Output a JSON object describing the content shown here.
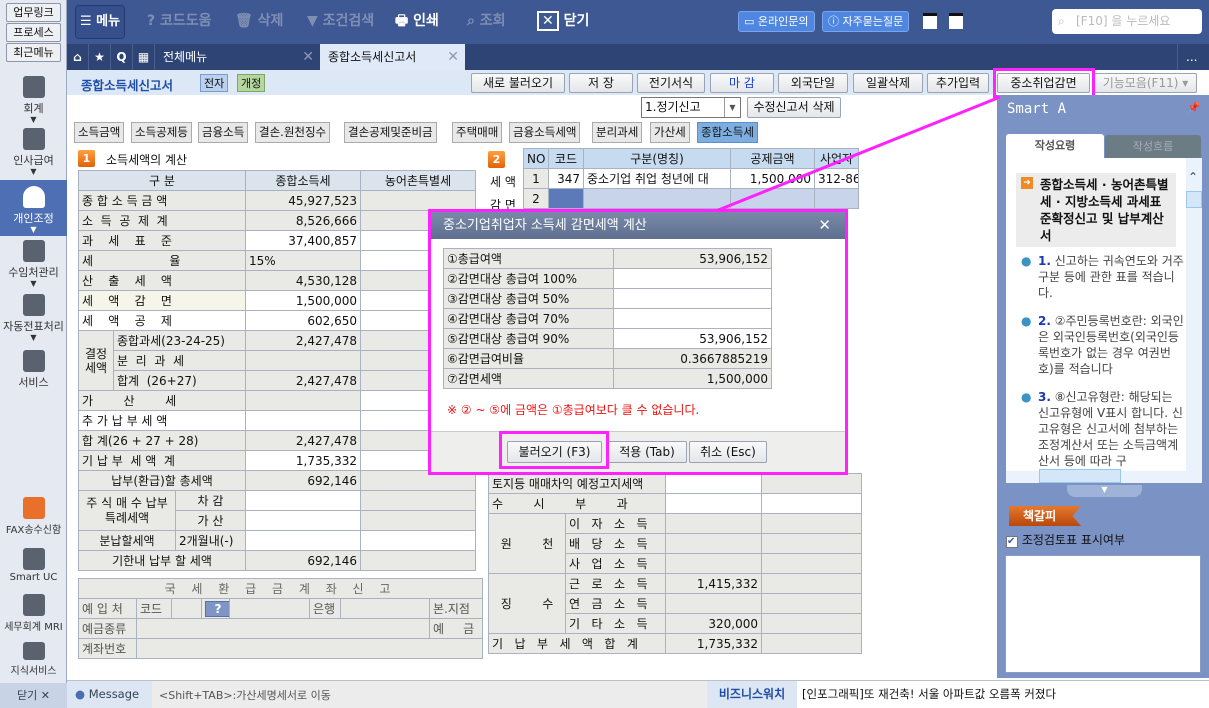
{
  "sidebar": {
    "top_buttons": [
      "업무링크",
      "프로세스",
      "최근메뉴"
    ],
    "nav": [
      {
        "label": "회계"
      },
      {
        "label": "인사급여"
      },
      {
        "label": "개인조정"
      },
      {
        "label": "수임처관리"
      },
      {
        "label": "자동전표처리"
      },
      {
        "label": "서비스"
      }
    ],
    "bottom": [
      {
        "label": "FAX송수신함"
      },
      {
        "label": "Smart UC"
      },
      {
        "label": "세무회계 MRI"
      },
      {
        "label": "지식서비스"
      }
    ],
    "close": "닫기 ✕"
  },
  "toolbar": {
    "menu": "메뉴",
    "code_help": "코드도움",
    "delete": "삭제",
    "filter": "조건검색",
    "print": "인쇄",
    "view": "조회",
    "close": "닫기",
    "online": "온라인문의",
    "faq": "자주묻는질문",
    "search_placeholder": "[F10] 을 누르세요"
  },
  "tabs": {
    "all_menu": "전체메뉴",
    "active": "종합소득세신고서",
    "more": "..."
  },
  "title": {
    "text": "종합소득세신고서",
    "tag1": "전자",
    "tag2": "개정"
  },
  "actions": [
    "새로 불러오기",
    "저  장",
    "전기서식",
    "마  감",
    "외국단일",
    "일괄삭제",
    "추가입력",
    "중소취업감면",
    "기능모음(F11) ▾"
  ],
  "report_type": "1.정기신고",
  "amend_delete": "수정신고서 삭제",
  "subtabs": [
    "소득금액",
    "소득공제등",
    "금융소득",
    "결손.원천징수",
    "결손공제및준비금",
    "주택매매",
    "금융소득세액",
    "분리과세",
    "가산세",
    "종합소득세"
  ],
  "section1": {
    "badge": "1",
    "title": "소득세액의 계산",
    "headers": [
      "구          분",
      "종합소득세",
      "농어촌특별세"
    ],
    "rows": [
      [
        "종 합 소 득 금 액",
        "45,927,523"
      ],
      [
        "소  득  공  제  계",
        "8,526,666"
      ],
      [
        "과    세    표    준",
        "37,400,857"
      ],
      [
        "세                    율",
        "15%"
      ],
      [
        "산    출    세    액",
        "4,530,128"
      ],
      [
        "세    액    감    면",
        "1,500,000"
      ],
      [
        "세    액    공    제",
        "602,650"
      ]
    ],
    "decided": {
      "label": "결정세액",
      "rows": [
        [
          "종합과세(23-24-25)",
          "2,427,478"
        ],
        [
          "분  리  과  세",
          ""
        ],
        [
          "합계  (26+27)",
          "2,427,478"
        ]
      ]
    },
    "rows2": [
      [
        "가        산        세",
        ""
      ],
      [
        "추 가 납 부 세 액",
        ""
      ],
      [
        "합 계(26 + 27 + 28)",
        "2,427,478"
      ],
      [
        "기 납 부  세 액  계",
        "1,735,332"
      ],
      [
        "납부(환급)할 총세액",
        "692,146"
      ]
    ],
    "stock": {
      "label": "주 식  매 수 납부특례세액",
      "sub": [
        "차 감",
        "가 산"
      ]
    },
    "installment": {
      "label": "분납할세액",
      "sub": "2개월내(-)"
    },
    "due": {
      "label": "기한내 납부 할 세액",
      "value": "692,146"
    }
  },
  "refund": {
    "title": "국 세 환 급 금 계 좌 신 고",
    "deposit": "예 입 처",
    "code": "코드",
    "bank": "은행",
    "branch": "본.지점",
    "type": "예금종류",
    "deposit2": "예     금",
    "account": "계좌번호",
    "help": "?"
  },
  "section2": {
    "badge": "2",
    "side": [
      "세 액",
      "감 면"
    ],
    "headers": [
      "NO",
      "코드",
      "구분(명칭)",
      "공제금액",
      "사업자"
    ],
    "rows": [
      [
        "1",
        "347",
        "중소기업 취업 청년에 대",
        "1,500,000",
        "312-86"
      ],
      [
        "2",
        "",
        "",
        "",
        ""
      ]
    ],
    "lower": [
      [
        "토지등 매매차익 예정고지세액",
        ""
      ],
      [
        "수        시        부        과",
        ""
      ]
    ],
    "withholding": {
      "label1": "원        천",
      "label2": "징        수",
      "rows": [
        [
          "이   자   소   득",
          ""
        ],
        [
          "배   당   소   득",
          ""
        ],
        [
          "사   업   소   득",
          ""
        ],
        [
          "근   로   소   득",
          "1,415,332"
        ],
        [
          "연   금   소   득",
          ""
        ],
        [
          "기   타   소   득",
          "320,000"
        ]
      ]
    },
    "total": [
      "기   납   부   세   액   합   계",
      "1,735,332"
    ]
  },
  "dialog": {
    "title": "중소기업취업자 소득세 감면세액 계산",
    "rows": [
      [
        "①총급여액",
        "53,906,152"
      ],
      [
        "②감면대상 총급여 100%",
        ""
      ],
      [
        "③감면대상 총급여 50%",
        ""
      ],
      [
        "④감면대상 총급여 70%",
        ""
      ],
      [
        "⑤감면대상 총급여 90%",
        "53,906,152"
      ],
      [
        "⑥감면급여비율",
        "0.3667885219"
      ],
      [
        "⑦감면세액",
        "1,500,000"
      ]
    ],
    "warning": "※ ② ~ ⑤에 금액은 ①총급여보다 클 수 없습니다.",
    "buttons": [
      "불러오기 (F3)",
      "적용 (Tab)",
      "취소 (Esc)"
    ]
  },
  "smart": {
    "title": "Smart A",
    "pin": "ㅁ",
    "tabs": [
      "작성요령",
      "작성흐름"
    ],
    "heading": "종합소득세 · 농어촌특별세 · 지방소득세 과세표준확정신고 및 납부계산서",
    "items": [
      {
        "n": "1.",
        "t": "신고하는 귀속연도와 거주구분 등에 관한 표를 적습니다."
      },
      {
        "n": "2.",
        "t": "②주민등록번호란: 외국인은 외국인등록번호(외국인등록번호가 없는 경우 여권번호)를 적습니다"
      },
      {
        "n": "3.",
        "t": "⑧신고유형란: 해당되는 신고유형에 V표시 합니다. 신고유형은 신고서에 첨부하는 조정계산서 또는 소득금액계산서 등에 따라 구"
      }
    ],
    "bookmark": "책갈피",
    "checkbox": "조정검토표 표시여부"
  },
  "status": {
    "message": "Message",
    "hint": "<Shift+TAB>:가산세명세서로 이동",
    "news_label": "비즈니스워치",
    "news": "[인포그래픽]또 재건축! 서울 아파트값 오름폭 커졌다"
  },
  "colors": {
    "highlight": "#ff22ff",
    "topbar": "#3e5893",
    "accent": "#4f6fb5"
  }
}
